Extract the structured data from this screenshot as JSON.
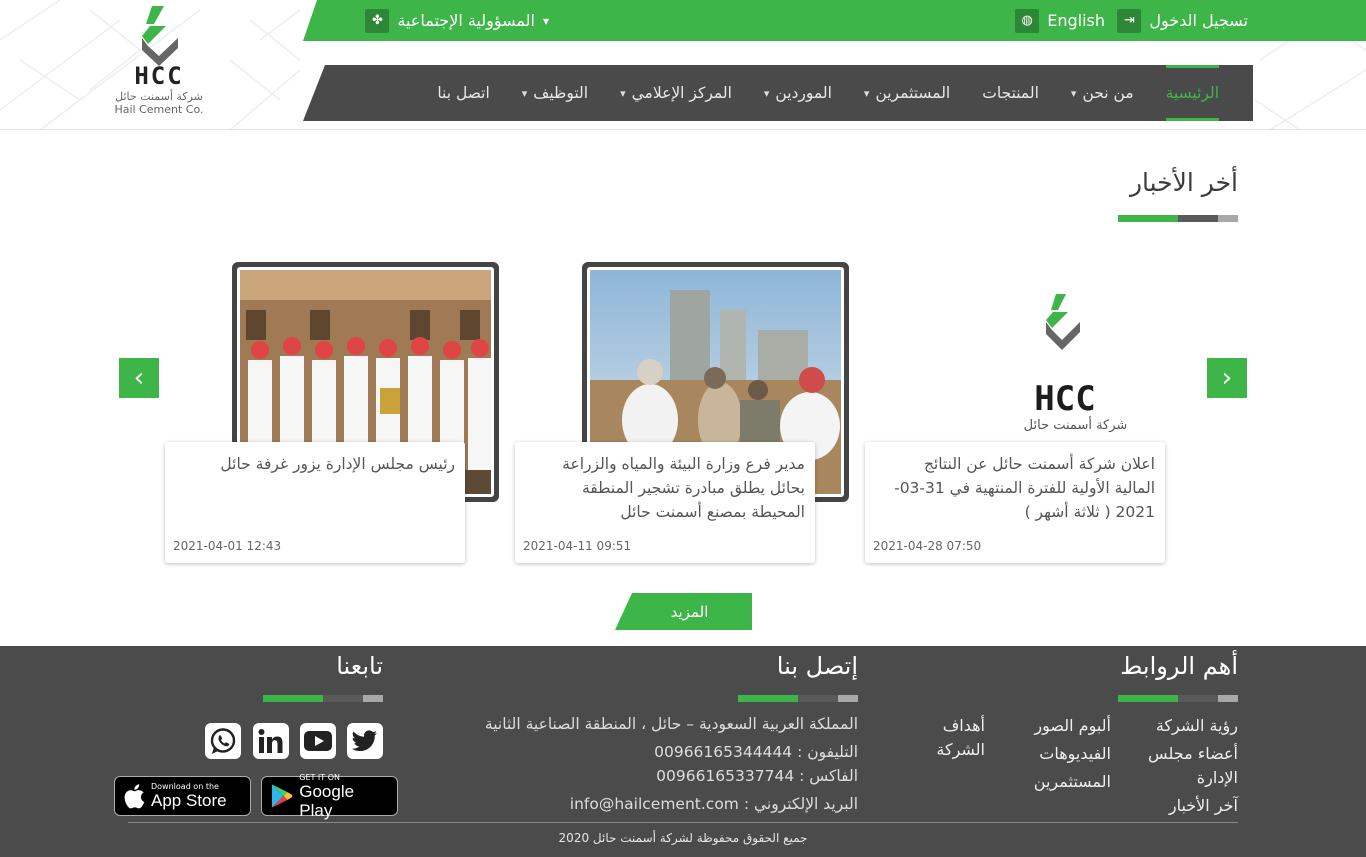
{
  "topbar": {
    "login_label": "تسجيل الدخول",
    "language_label": "English",
    "csr_label": "المسؤولية الإجتماعية"
  },
  "logo": {
    "letters": "HCC",
    "name_ar": "شركة أسمنت حائل",
    "name_en": "Hail Cement Co."
  },
  "nav": {
    "items": [
      {
        "label": "الرئيسية",
        "active": true,
        "dropdown": false
      },
      {
        "label": "من نحن",
        "active": false,
        "dropdown": true
      },
      {
        "label": "المنتجات",
        "active": false,
        "dropdown": false
      },
      {
        "label": "المستثمرين",
        "active": false,
        "dropdown": true
      },
      {
        "label": "الموردين",
        "active": false,
        "dropdown": true
      },
      {
        "label": "المركز الإعلامي",
        "active": false,
        "dropdown": true
      },
      {
        "label": "التوظيف",
        "active": false,
        "dropdown": true
      },
      {
        "label": "اتصل بنا",
        "active": false,
        "dropdown": false
      }
    ]
  },
  "news": {
    "title": "أخر الأخبار",
    "more_label": "المزيد",
    "cards": [
      {
        "text": "اعلان شركة أسمنت حائل عن النتائج المالية الأولية للفترة المنتهية في 31-03-2021 ( ثلاثة أشهر )",
        "date": "2021-04-28 07:50",
        "logo_caption": "شركة أسمنت حائل"
      },
      {
        "text": "مدير فرع وزارة البيئة والمياه والزراعة بحائل يطلق مبادرة تشجير المنطقة المحيطة بمصنع أسمنت حائل",
        "date": "2021-04-11 09:51"
      },
      {
        "text": "رئيس مجلس الإدارة يزور غرفة حائل",
        "date": "2021-04-01 12:43"
      }
    ]
  },
  "footer": {
    "links_title": "أهم الروابط",
    "links_col1": [
      "رؤية الشركة",
      "أعضاء مجلس الإدارة",
      "آخر الأخبار"
    ],
    "links_col2": [
      "ألبوم الصور",
      "الفيديوهات",
      "المستثمرين"
    ],
    "links_col3": [
      "أهداف الشركة"
    ],
    "contact_title": "إتصل بنا",
    "address": "المملكة العربية السعودية – حائل ، المنطقة الصناعية الثانية",
    "phone": "التليفون : 00966165344444",
    "fax": "الفاكس : 00966165337744",
    "email": "البريد الإلكتروني : info@hailcement.com",
    "follow_title": "تابعنا",
    "app_store": {
      "small": "Download on the",
      "big": "App Store"
    },
    "google_play": {
      "small": "GET IT ON",
      "big": "Google Play"
    },
    "copyright": "جميع الحقوق محفوظة لشركة أسمنت حائل 2020"
  },
  "colors": {
    "accent": "#3db548",
    "dark": "#4a4a4a",
    "footer": "#4b4b4b"
  }
}
